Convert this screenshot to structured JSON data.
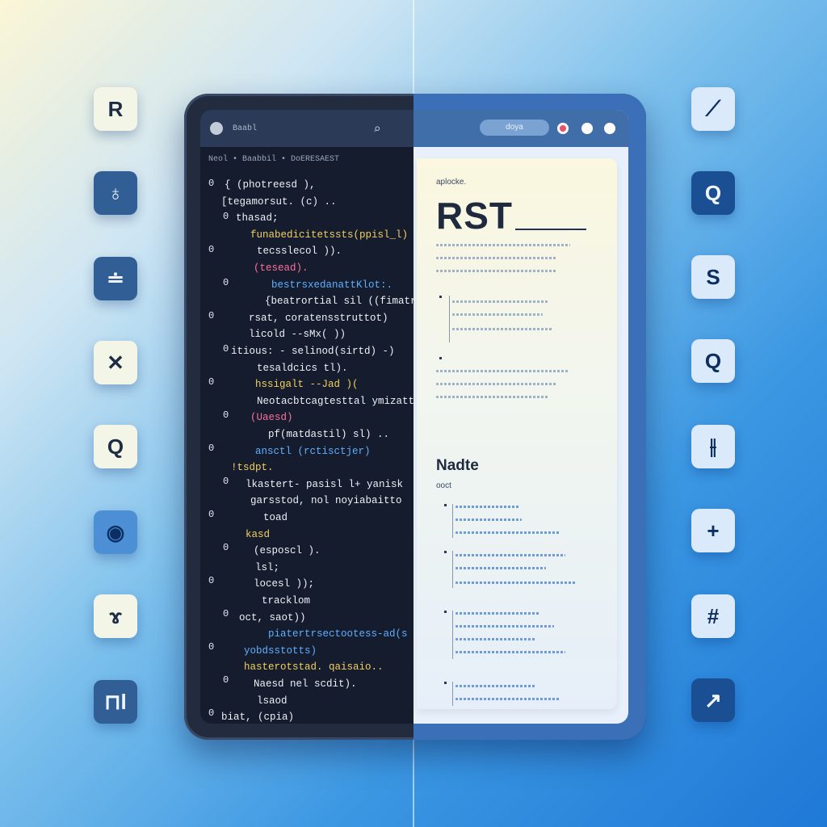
{
  "device": {
    "topbar_left_text": "Baabl",
    "pill_text": "doya",
    "breadcrumb": "Neol  •  Baabbil  •  DoERESAEST"
  },
  "code_gutter": [
    "0",
    "0",
    "0",
    "0",
    "0",
    "0",
    "0",
    "0",
    "0",
    "0",
    "0",
    "0",
    "0",
    "0",
    "0",
    "0",
    "0"
  ],
  "code_lines": [
    {
      "text": "{ (photreesd ),",
      "color": "white"
    },
    {
      "text": "[tegamorsut. (c) ..",
      "color": "white"
    },
    {
      "text": "thasad;",
      "color": "white"
    },
    {
      "text": "funabedicitetssts(ppisl_l)",
      "color": "yellow"
    },
    {
      "text": "tecsslecol )).",
      "color": "white"
    },
    {
      "text": "(tesead).",
      "color": "pink"
    },
    {
      "text": "bestrsxedanattKlot:.",
      "color": "blue"
    },
    {
      "text": "{beatrortial sil ((fimatr",
      "color": "white"
    },
    {
      "text": "rsat, coratensstruttot)",
      "color": "white"
    },
    {
      "text": "licold --sMx( ))",
      "color": "white"
    },
    {
      "text": "itious: - selinod(sirtd) -)",
      "color": "white"
    },
    {
      "text": "tesaldcics tl).",
      "color": "white"
    },
    {
      "text": "hssigalt --Jad )(",
      "color": "yellow"
    },
    {
      "text": "Neotacbtcagtesttal ymizatt",
      "color": "white"
    },
    {
      "text": "(Uaesd)",
      "color": "pink"
    },
    {
      "text": "pf(matdastil) sl) ..",
      "color": "white"
    },
    {
      "text": "ansctl (rctisctjer)",
      "color": "blue"
    },
    {
      "text": "!tsdpt.",
      "color": "yellow"
    },
    {
      "text": "lkastert- pasisl l+ yanisk",
      "color": "white"
    },
    {
      "text": "garsstod, nol noyiabaitto",
      "color": "white"
    },
    {
      "text": "toad",
      "color": "white"
    },
    {
      "text": "kasd",
      "color": "yellow"
    },
    {
      "text": "(esposcl ).",
      "color": "white"
    },
    {
      "text": "lsl;",
      "color": "white"
    },
    {
      "text": "locesl  ));",
      "color": "white"
    },
    {
      "text": "tracklom",
      "color": "white"
    },
    {
      "text": "oct,  saot))",
      "color": "white"
    },
    {
      "text": "piatertrsectootess-ad(s",
      "color": "blue"
    },
    {
      "text": "yobdsstotts)",
      "color": "blue"
    },
    {
      "text": "hasterotstad. qaisaio..",
      "color": "yellow"
    },
    {
      "text": "Naesd nel scdit).",
      "color": "white"
    },
    {
      "text": "lsaod",
      "color": "white"
    },
    {
      "text": "biat,   (cpia)",
      "color": "white"
    }
  ],
  "document": {
    "kicker": "aplocke.",
    "title": "RST",
    "heading": "Nadte",
    "subheading": "ooct"
  },
  "side_icons_left": [
    {
      "name": "r-letter-icon",
      "glyph": "R"
    },
    {
      "name": "award-icon",
      "glyph": "♁"
    },
    {
      "name": "stack-icon",
      "glyph": "≐"
    },
    {
      "name": "close-icon",
      "glyph": "✕"
    },
    {
      "name": "refresh-icon",
      "glyph": "Q"
    },
    {
      "name": "circle-icon",
      "glyph": "◉"
    },
    {
      "name": "chevron-icon",
      "glyph": "ɤ"
    },
    {
      "name": "pm-icon",
      "glyph": "⊓l"
    }
  ],
  "side_icons_right": [
    {
      "name": "pen-icon",
      "glyph": "⟋"
    },
    {
      "name": "q-icon",
      "glyph": "Q"
    },
    {
      "name": "s-icon",
      "glyph": "S"
    },
    {
      "name": "search-icon",
      "glyph": "Q"
    },
    {
      "name": "pause-icon",
      "glyph": "⫲"
    },
    {
      "name": "plus-icon",
      "glyph": "+"
    },
    {
      "name": "hash-icon",
      "glyph": "#"
    },
    {
      "name": "curve-icon",
      "glyph": "↗"
    }
  ]
}
